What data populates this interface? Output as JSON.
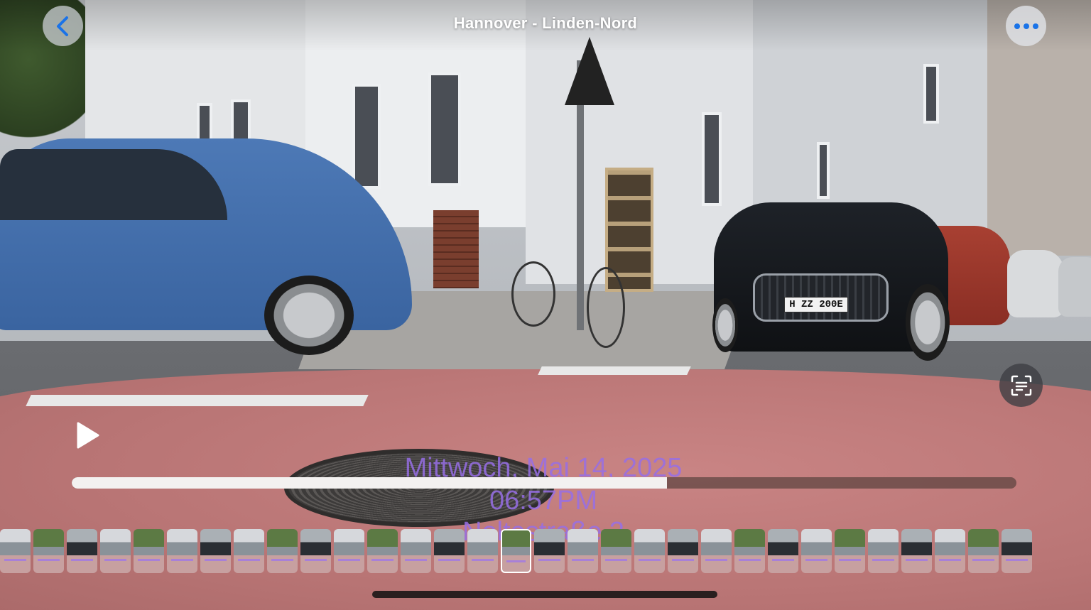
{
  "header": {
    "title": "Hannover - Linden-Nord",
    "back_icon": "chevron-left-icon",
    "more_icon": "ellipsis-icon"
  },
  "photo": {
    "license_plate": "H ZZ 200E"
  },
  "overlay": {
    "date": "Mittwoch, Mai 14, 2025",
    "time": "06:57PM",
    "street": "Noltestraße 3"
  },
  "player": {
    "play_icon": "play-icon",
    "live_text_icon": "live-text-icon",
    "progress_fraction": 0.63
  },
  "filmstrip": {
    "thumbnail_count": 31,
    "active_index": 15
  },
  "colors": {
    "accent": "#1a73e8",
    "overlay_text": "#9a70e6"
  }
}
